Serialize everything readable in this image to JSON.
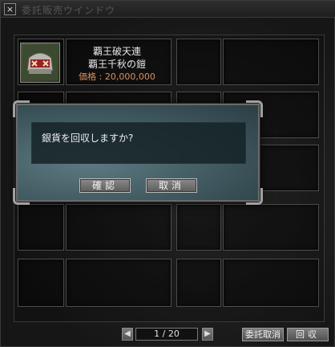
{
  "window": {
    "title": "委託販売ウインドウ",
    "close_glyph": "×"
  },
  "item": {
    "name": "覇王破天連",
    "sub_name": "覇王千秋の鎧",
    "price": "価格 : 20,000,000"
  },
  "dialog": {
    "message": "銀貨を回収しますか?",
    "confirm_label": "確認",
    "cancel_label": "取消"
  },
  "pager": {
    "prev_glyph": "◀",
    "next_glyph": "▶",
    "page_display": "1 / 20"
  },
  "buttons": {
    "consign_cancel_label": "委託取消",
    "collect_label": "回収"
  }
}
